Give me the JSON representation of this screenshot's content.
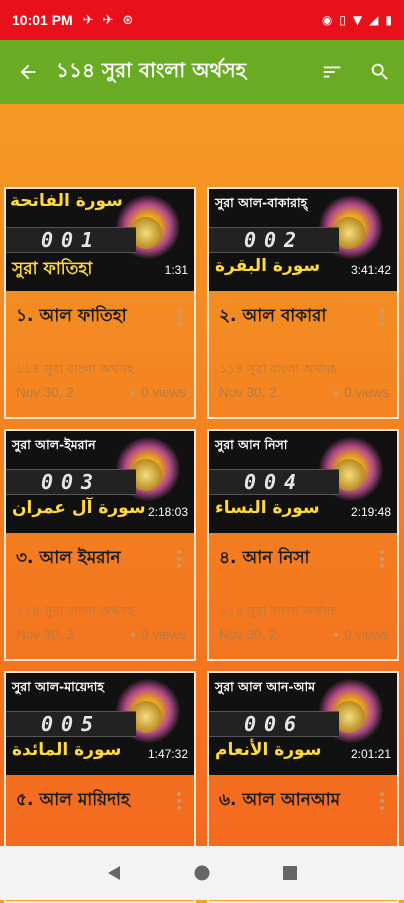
{
  "status_bar": {
    "time": "10:01 PM",
    "left_icons": [
      "airplane-bird-icon",
      "airplane-bird-icon",
      "vpn-icon"
    ],
    "right_icons": [
      "eye-icon",
      "vibrate-icon",
      "wifi-icon",
      "signal-icon",
      "battery-icon"
    ]
  },
  "app_bar": {
    "title": "১১৪ সুরা বাংলা অর্থসহ",
    "color": "#6aab24"
  },
  "videos": [
    {
      "thumb_top": "سورة الفاتحة",
      "thumb_number": "001",
      "thumb_bottom": "সুরা ফাতিহা",
      "duration": "1:31",
      "title": "১. আল ফাতিহা",
      "channel": "১১৪ সুরা বাংলা অর্থসহ",
      "date": "Nov 30, 2",
      "views": "0 views"
    },
    {
      "thumb_top": "সুরা আল-বাকারাহ্",
      "thumb_number": "002",
      "thumb_bottom": "سورة البقرة",
      "duration": "3:41:42",
      "title": "২. আল বাকারা",
      "channel": "১১৪ সুরা বাংলা অর্থসহ",
      "date": "Nov 30, 2",
      "views": "0 views"
    },
    {
      "thumb_top": "সুরা আল-ইমরান",
      "thumb_number": "003",
      "thumb_bottom": "سورة آل عمران",
      "duration": "2:18:03",
      "title": "৩. আল ইমরান",
      "channel": "১১৪ সুরা বাংলা অর্থসহ",
      "date": "Nov 30, 2",
      "views": "0 views"
    },
    {
      "thumb_top": "সুরা আন নিসা",
      "thumb_number": "004",
      "thumb_bottom": "سورة النساء",
      "duration": "2:19:48",
      "title": "৪. আন নিসা",
      "channel": "১১৪ সুরা বাংলা অর্থসহ",
      "date": "Nov 30, 2",
      "views": "0 views"
    },
    {
      "thumb_top": "সুরা আল-মায়েদাহ",
      "thumb_number": "005",
      "thumb_bottom": "سورة المائدة",
      "duration": "1:47:32",
      "title": "৫. আল মায়িদাহ",
      "channel": "",
      "date": "",
      "views": ""
    },
    {
      "thumb_top": "সুরা আল আন-আম",
      "thumb_number": "006",
      "thumb_bottom": "سورة الأنعام",
      "duration": "2:01:21",
      "title": "৬. আল আনআম",
      "channel": "",
      "date": "",
      "views": ""
    }
  ],
  "nav_bar": {
    "buttons": [
      "back-triangle-icon",
      "home-circle-icon",
      "recents-square-icon"
    ]
  }
}
